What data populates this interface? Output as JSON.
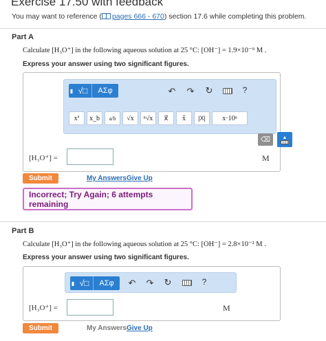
{
  "header": {
    "title": "Exercise 17.50 with feedback",
    "ref_prefix": "You may want to reference (",
    "ref_link": "pages 666 - 670",
    "ref_suffix": ") section 17.6 while completing this problem."
  },
  "toolbar": {
    "sqrt_label": "√□",
    "greek_label": "ΑΣφ",
    "help_label": "?",
    "templates": [
      "xª",
      "x_b",
      "a/b",
      "√x",
      "ⁿ√x",
      "x⃗",
      "x̂",
      "|X|",
      "x·10ⁿ"
    ]
  },
  "part_a": {
    "label": "Part A",
    "question_prefix": "Calculate [H₃O⁺] in the following aqueous solution at 25 °C: [OH⁻] = 1.9×10⁻⁹ M .",
    "instruction": "Express your answer using two significant figures.",
    "input_label": "[H₃O⁺] =",
    "input_value": "",
    "unit": "M",
    "submit_label": "Submit",
    "my_answers_label": "My Answers",
    "give_up_label": "Give Up",
    "feedback": "Incorrect; Try Again; 6 attempts remaining"
  },
  "part_b": {
    "label": "Part B",
    "question_prefix": "Calculate [H₃O⁺] in the following aqueous solution at 25 °C: [OH⁻] = 2.8×10⁻² M .",
    "instruction": "Express your answer using two significant figures.",
    "input_label": "[H₃O⁺] =",
    "input_value": "",
    "unit": "M",
    "submit_label": "Submit",
    "my_answers_label": "My Answers",
    "give_up_label": "Give Up"
  },
  "colors": {
    "accent": "#2b7fd1",
    "submit": "#f1883c",
    "feedback_border": "#c86fc8",
    "feedback_text": "#7a1b7a",
    "link": "#2a6db5"
  }
}
